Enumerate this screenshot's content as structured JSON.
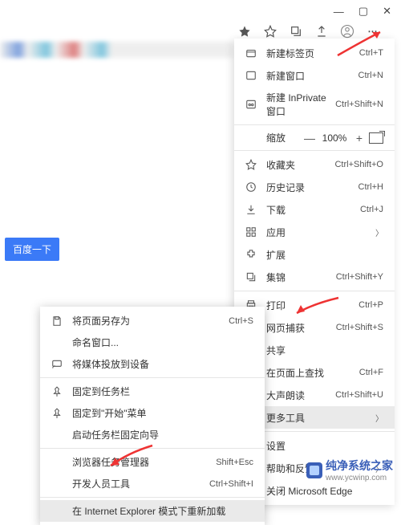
{
  "titlebar": {
    "min": "—",
    "max": "▢",
    "close": "✕"
  },
  "toolbar": {
    "more": "⋯"
  },
  "main_menu": {
    "new_tab": {
      "label": "新建标签页",
      "shortcut": "Ctrl+T"
    },
    "new_window": {
      "label": "新建窗口",
      "shortcut": "Ctrl+N"
    },
    "new_inprivate": {
      "label": "新建 InPrivate 窗口",
      "shortcut": "Ctrl+Shift+N"
    },
    "zoom": {
      "label": "缩放",
      "value": "100%",
      "minus": "—",
      "plus": "+"
    },
    "favorites": {
      "label": "收藏夹",
      "shortcut": "Ctrl+Shift+O"
    },
    "history": {
      "label": "历史记录",
      "shortcut": "Ctrl+H"
    },
    "downloads": {
      "label": "下载",
      "shortcut": "Ctrl+J"
    },
    "apps": {
      "label": "应用"
    },
    "extensions": {
      "label": "扩展"
    },
    "collections": {
      "label": "集锦",
      "shortcut": "Ctrl+Shift+Y"
    },
    "print": {
      "label": "打印",
      "shortcut": "Ctrl+P"
    },
    "capture": {
      "label": "网页捕获",
      "shortcut": "Ctrl+Shift+S"
    },
    "share": {
      "label": "共享"
    },
    "find": {
      "label": "在页面上查找",
      "shortcut": "Ctrl+F"
    },
    "read_aloud": {
      "label": "大声朗读",
      "shortcut": "Ctrl+Shift+U"
    },
    "more_tools": {
      "label": "更多工具"
    },
    "settings": {
      "label": "设置"
    },
    "help": {
      "label": "帮助和反馈"
    },
    "close_edge": {
      "label": "关闭 Microsoft Edge"
    }
  },
  "sub_menu": {
    "save_as": {
      "label": "将页面另存为",
      "shortcut": "Ctrl+S"
    },
    "name_window": {
      "label": "命名窗口..."
    },
    "cast": {
      "label": "将媒体投放到设备"
    },
    "pin_taskbar": {
      "label": "固定到任务栏"
    },
    "pin_start": {
      "label": "固定到\"开始\"菜单"
    },
    "launch_guide": {
      "label": "启动任务栏固定向导"
    },
    "task_manager": {
      "label": "浏览器任务管理器",
      "shortcut": "Shift+Esc"
    },
    "dev_tools": {
      "label": "开发人员工具",
      "shortcut": "Ctrl+Shift+I"
    },
    "ie_mode": {
      "label": "在 Internet Explorer 模式下重新加载"
    }
  },
  "baidu_btn": "百度一下",
  "watermark": {
    "name": "纯净系统之家",
    "url": "www.ycwinp.com"
  }
}
